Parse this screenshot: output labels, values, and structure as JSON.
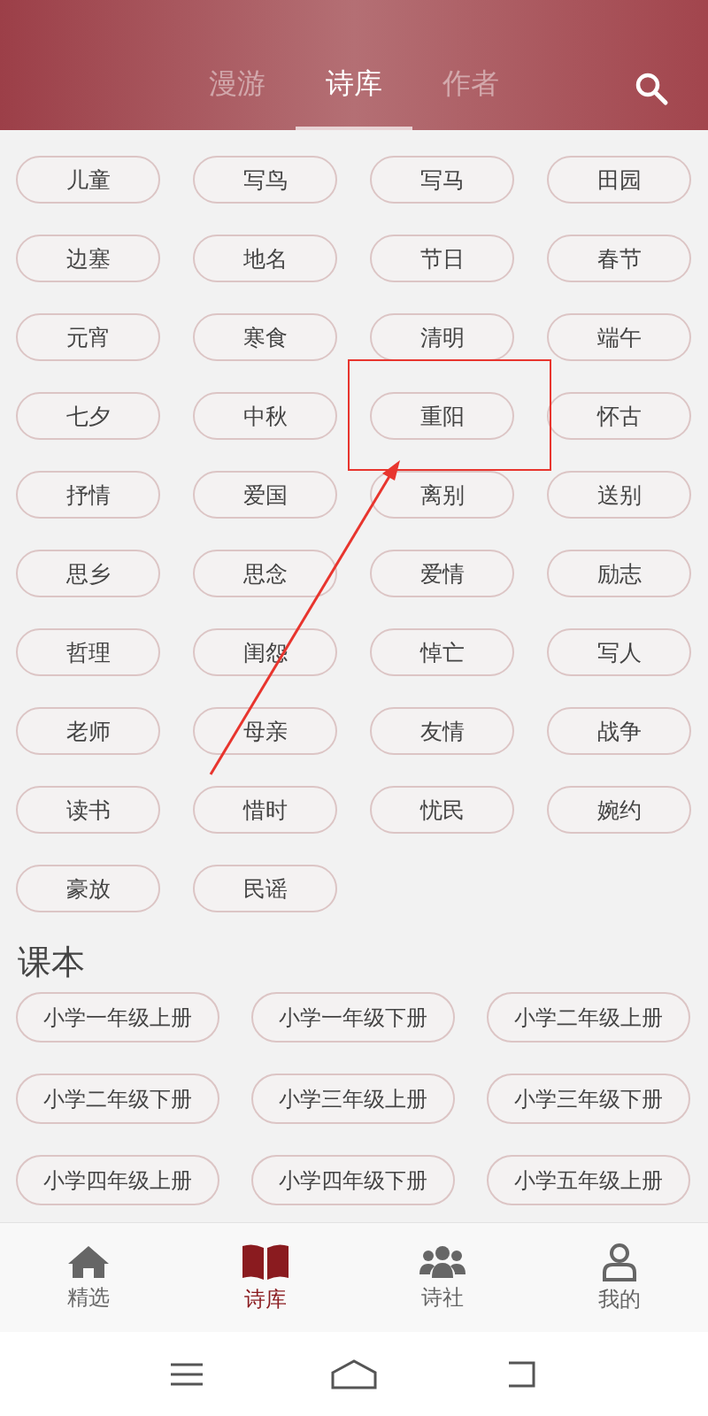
{
  "tabs": [
    {
      "label": "漫游",
      "selected": false
    },
    {
      "label": "诗库",
      "selected": true
    },
    {
      "label": "作者",
      "selected": false
    }
  ],
  "tags": [
    "儿童",
    "写鸟",
    "写马",
    "田园",
    "边塞",
    "地名",
    "节日",
    "春节",
    "元宵",
    "寒食",
    "清明",
    "端午",
    "七夕",
    "中秋",
    "重阳",
    "怀古",
    "抒情",
    "爱国",
    "离别",
    "送别",
    "思乡",
    "思念",
    "爱情",
    "励志",
    "哲理",
    "闺怨",
    "悼亡",
    "写人",
    "老师",
    "母亲",
    "友情",
    "战争",
    "读书",
    "惜时",
    "忧民",
    "婉约",
    "豪放",
    "民谣"
  ],
  "textbook": {
    "title": "课本",
    "items": [
      "小学一年级上册",
      "小学一年级下册",
      "小学二年级上册",
      "小学二年级下册",
      "小学三年级上册",
      "小学三年级下册",
      "小学四年级上册",
      "小学四年级下册",
      "小学五年级上册"
    ]
  },
  "bottom_nav": [
    {
      "label": "精选",
      "selected": false
    },
    {
      "label": "诗库",
      "selected": true
    },
    {
      "label": "诗社",
      "selected": false
    },
    {
      "label": "我的",
      "selected": false
    }
  ]
}
